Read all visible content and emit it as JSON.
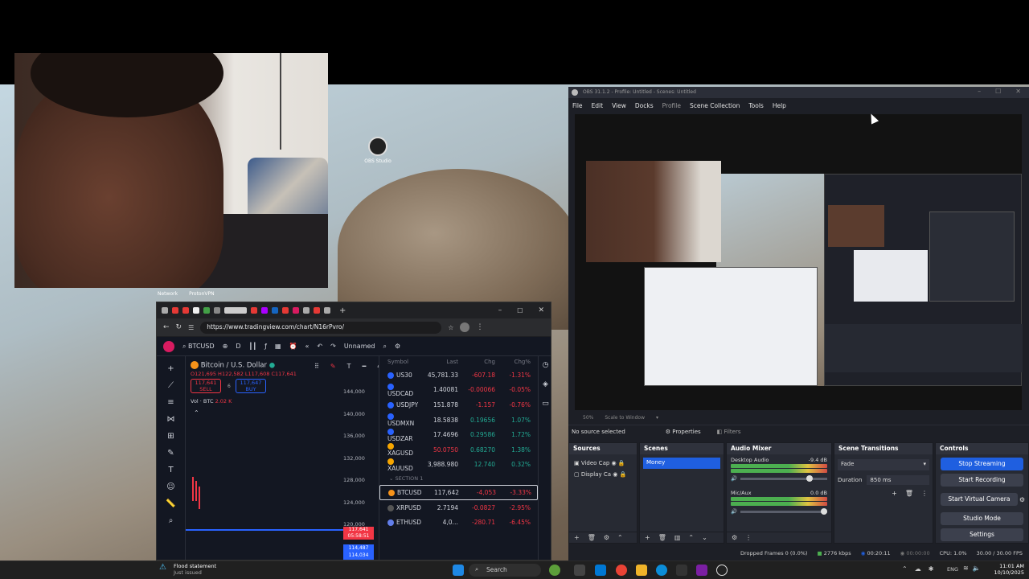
{
  "desktop": {
    "icon_label": "OBS Studio",
    "partial_icon_labels": [
      "Network",
      "ProtonVPN"
    ]
  },
  "browser": {
    "url": "https://www.tradingview.com/chart/N16rPvro/",
    "symbol": "BTCUSD",
    "interval": "D",
    "layout_name": "Unnamed",
    "chart_title": "Bitcoin / U.S. Dollar",
    "ohlc": "O121,695 H122,582 L117,608 C117,641",
    "sell_price": "117,641",
    "sell_label": "SELL",
    "spread": "6",
    "buy_price": "117,647",
    "buy_label": "BUY",
    "volume": "Vol · BTC",
    "volume_value": "2.02 K",
    "stroke_width": "4px",
    "price_axis": [
      "144,000",
      "140,000",
      "136,000",
      "132,000",
      "128,000",
      "124,000",
      "120,000"
    ],
    "last_price_tag": "117,641",
    "last_price_countdown": "05:58:51",
    "low_tag": "114,487",
    "low_tag2": "114,034",
    "watchlist_headers": [
      "Symbol",
      "Last",
      "Chg",
      "Chg%"
    ],
    "watchlist": [
      {
        "symbol": "US30",
        "last": "45,781.33",
        "chg": "-607.18",
        "pct": "-1.31%",
        "dir": "neg",
        "color": "#2962ff"
      },
      {
        "symbol": "USDCAD",
        "last": "1.40081",
        "chg": "-0.00066",
        "pct": "-0.05%",
        "dir": "neg",
        "color": "#2962ff"
      },
      {
        "symbol": "USDJPY",
        "last": "151.878",
        "chg": "-1.157",
        "pct": "-0.76%",
        "dir": "neg",
        "color": "#2962ff"
      },
      {
        "symbol": "USDMXN",
        "last": "18.5838",
        "chg": "0.19656",
        "pct": "1.07%",
        "dir": "pos",
        "color": "#2962ff"
      },
      {
        "symbol": "USDZAR",
        "last": "17.4696",
        "chg": "0.29586",
        "pct": "1.72%",
        "dir": "pos",
        "color": "#2962ff"
      },
      {
        "symbol": "XAGUSD",
        "last": "50.0750",
        "chg": "0.68270",
        "pct": "1.38%",
        "dir": "pos",
        "color": "#f7a600",
        "last_color": "#f23645"
      },
      {
        "symbol": "XAUUSD",
        "last": "3,988.980",
        "chg": "12.740",
        "pct": "0.32%",
        "dir": "pos",
        "color": "#f7a600"
      }
    ],
    "section_label": "SECTION 1",
    "watchlist2": [
      {
        "symbol": "BTCUSD",
        "last": "117,642",
        "chg": "-4,053",
        "pct": "-3.33%",
        "dir": "neg",
        "color": "#f7931a",
        "selected": true
      },
      {
        "symbol": "XRPUSD",
        "last": "2.7194",
        "chg": "-0.0827",
        "pct": "-2.95%",
        "dir": "neg",
        "color": "#555"
      },
      {
        "symbol": "ETHUSD",
        "last": "4,0…",
        "chg": "-280.71",
        "pct": "-6.45%",
        "dir": "neg",
        "color": "#627eea"
      }
    ]
  },
  "obs": {
    "title": "OBS 31.1.2 - Profile: Untitled - Scenes: Untitled",
    "menu": [
      "File",
      "Edit",
      "View",
      "Docks",
      "Profile",
      "Scene Collection",
      "Tools",
      "Help"
    ],
    "zoom": "50%",
    "scale_mode": "Scale to Window",
    "no_source": "No source selected",
    "properties_label": "Properties",
    "filters_label": "Filters",
    "sources_header": "Sources",
    "sources": [
      "Video Cap",
      "Display Ca"
    ],
    "scenes_header": "Scenes",
    "scenes": [
      "Money"
    ],
    "mixer_header": "Audio Mixer",
    "mixer": [
      {
        "name": "Desktop Audio",
        "db": "-9.4 dB"
      },
      {
        "name": "Mic/Aux",
        "db": "0.0 dB"
      }
    ],
    "transitions_header": "Scene Transitions",
    "transition": "Fade",
    "duration_label": "Duration",
    "duration_value": "850 ms",
    "controls_header": "Controls",
    "controls": [
      "Stop Streaming",
      "Start Recording",
      "Start Virtual Camera",
      "Studio Mode",
      "Settings"
    ],
    "dropped_frames": "Dropped Frames 0 (0.0%)",
    "bitrate": "2776 kbps",
    "stream_time": "00:20:11",
    "record_time": "00:00:00",
    "cpu": "CPU: 1.0%",
    "fps": "30.00 / 30.00 FPS"
  },
  "taskbar": {
    "weather_title": "Flood statement",
    "weather_sub": "Just issued",
    "search_placeholder": "Search",
    "language": "ENG",
    "time": "11:01 AM",
    "date": "10/10/2025"
  },
  "colors": {
    "obs_accent": "#1f5fe0",
    "tv_bg": "#131722",
    "neg": "#f23645",
    "pos": "#22ab94"
  }
}
